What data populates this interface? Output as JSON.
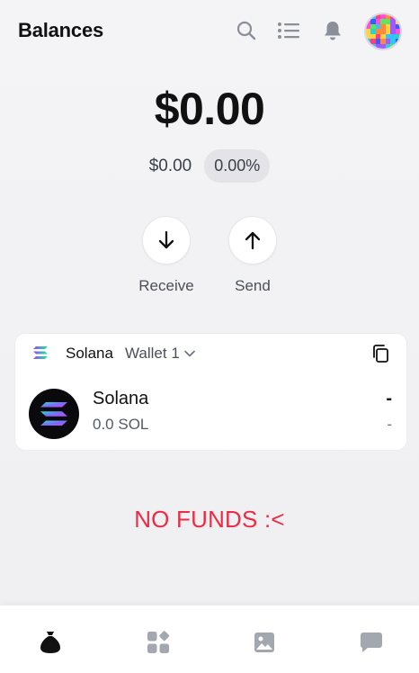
{
  "header": {
    "title": "Balances",
    "icons": [
      "search-icon",
      "list-icon",
      "bell-icon",
      "avatar"
    ]
  },
  "balance": {
    "total": "$0.00",
    "change_usd": "$0.00",
    "change_pct": "0.00%"
  },
  "actions": [
    {
      "label": "Receive",
      "icon": "arrow-down-icon"
    },
    {
      "label": "Send",
      "icon": "arrow-up-icon"
    }
  ],
  "wallet_card": {
    "chain": "Solana",
    "wallet_name": "Wallet 1",
    "token": {
      "name": "Solana",
      "balance": "0.0 SOL",
      "usd_value": "-",
      "change": "-"
    }
  },
  "notice": "NO FUNDS :<",
  "bottom_nav": [
    "tokens-icon",
    "apps-icon",
    "collectibles-icon",
    "messages-icon"
  ],
  "colors": {
    "accent_red": "#ec2b45",
    "text_primary": "#111111",
    "background": "#f1f1f3"
  }
}
